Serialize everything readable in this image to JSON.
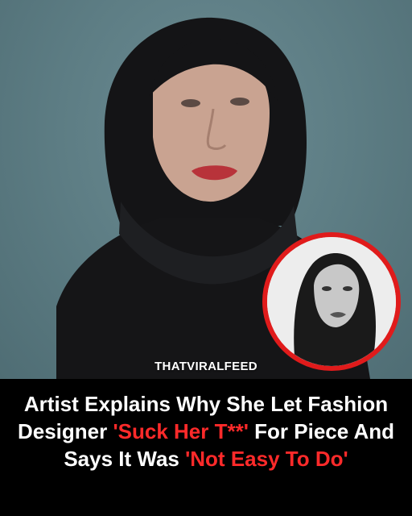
{
  "source_label": "THATVIRALFEED",
  "headline": {
    "part1": "Artist Explains Why She Let Fashion Designer ",
    "highlight1": "'Suck Her T**'",
    "part2": " For Piece And Says It Was ",
    "highlight2": "'Not Easy To Do'"
  },
  "colors": {
    "background": "#5f7f86",
    "caption_background": "#000000",
    "caption_text": "#ffffff",
    "highlight": "#ff2a2a",
    "inset_border": "#e01b1b"
  }
}
